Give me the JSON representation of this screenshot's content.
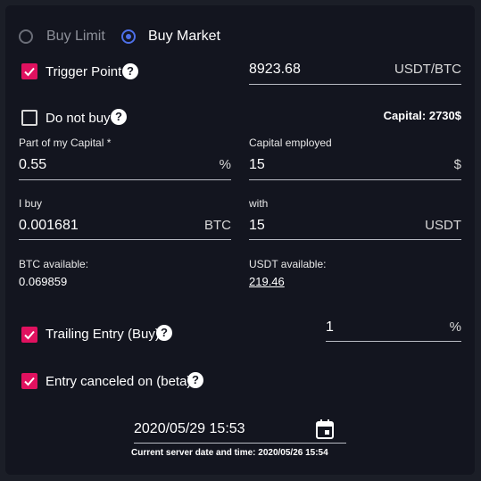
{
  "order_type": {
    "options": [
      {
        "label": "Buy Limit",
        "selected": false
      },
      {
        "label": "Buy Market",
        "selected": true
      }
    ]
  },
  "trigger": {
    "label": "Trigger Point",
    "checked": true,
    "value": "8923.68",
    "unit": "USDT/BTC"
  },
  "do_not_buy": {
    "label": "Do not buy",
    "checked": false
  },
  "capital": {
    "text": "Capital: 2730$"
  },
  "part_capital": {
    "label": "Part of my Capital *",
    "value": "0.55",
    "unit": "%"
  },
  "capital_employed": {
    "label": "Capital employed",
    "value": "15",
    "unit": "$"
  },
  "i_buy": {
    "label": "I buy",
    "value": "0.001681",
    "unit": "BTC"
  },
  "with": {
    "label": "with",
    "value": "15",
    "unit": "USDT"
  },
  "btc_available": {
    "label": "BTC available:",
    "value": "0.069859"
  },
  "usdt_available": {
    "label": "USDT available:",
    "value": "219.46"
  },
  "trailing": {
    "label": "Trailing Entry (Buy)",
    "checked": true,
    "value": "1",
    "unit": "%"
  },
  "entry_canceled": {
    "label": "Entry canceled on (beta)",
    "checked": true
  },
  "datetime": {
    "value": "2020/05/29 15:53",
    "server_text": "Current server date and time: 2020/05/26 15:54"
  },
  "help_glyph": "?",
  "colors": {
    "accent_pink": "#e0115f",
    "accent_blue": "#4d6fe8",
    "panel_bg": "#13151f"
  }
}
